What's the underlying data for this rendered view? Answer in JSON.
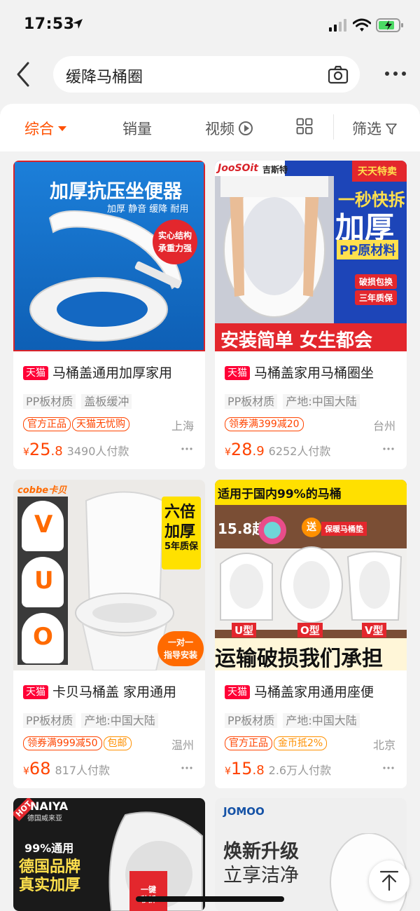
{
  "status_bar": {
    "time": "17:53"
  },
  "search": {
    "query": "缓降马桶圈"
  },
  "filters": [
    {
      "label": "综合"
    },
    {
      "label": "销量"
    },
    {
      "label": "视频"
    },
    {
      "label": "筛选"
    }
  ],
  "products": [
    {
      "img_headline": "加厚抗压坐便器",
      "img_sub": "加厚 静音 缓降 耐用",
      "img_badge_1": "实心结构",
      "img_badge_2": "承重力强",
      "badge": "天猫",
      "title": "马桶盖通用加厚家用",
      "tags": [
        "PP板材质",
        "盖板缓冲"
      ],
      "promos": [
        "官方正品",
        "天猫无忧购"
      ],
      "city": "上海",
      "price_int": "25",
      "price_dec": ".8",
      "sales": "3490人付款"
    },
    {
      "img_brand": "JooSOit",
      "img_brand_cn": "吉斯特",
      "img_corner": "天天特卖",
      "img_line_1": "一秒快拆",
      "img_line_2": "加厚",
      "img_line_3": "PP原材料",
      "img_badge_1": "破损包换",
      "img_badge_2": "三年质保",
      "img_bottom": "安装简单 女生都会",
      "badge": "天猫",
      "title": "马桶盖家用马桶圈坐",
      "tags": [
        "PP板材质",
        "产地:中国大陆"
      ],
      "promos": [
        "领券满399减20"
      ],
      "city": "台州",
      "price_int": "28",
      "price_dec": ".9",
      "sales": "6252人付款"
    },
    {
      "img_brand": "cobbe卡贝",
      "img_letters": [
        "V",
        "U",
        "O"
      ],
      "img_side_1": "六倍",
      "img_side_2": "加厚",
      "img_side_3": "5年质保",
      "img_btn_1": "一对一",
      "img_btn_2": "指导安装",
      "badge": "天猫",
      "title": "卡贝马桶盖 家用通用",
      "tags": [
        "PP板材质",
        "产地:中国大陆"
      ],
      "promos": [
        "领券满999减50",
        "包邮"
      ],
      "city": "温州",
      "price_int": "68",
      "price_dec": "",
      "sales": "817人付款"
    },
    {
      "img_top": "适用于国内99%的马桶",
      "img_price": "15.8起",
      "img_gift_1": "送",
      "img_gift_2": "保暖马桶垫",
      "img_types": [
        "U型",
        "O型",
        "V型"
      ],
      "img_bottom": "运输破损我们承担",
      "badge": "天猫",
      "title": "马桶盖家用通用座便",
      "tags": [
        "PP板材质",
        "产地:中国大陆"
      ],
      "promos": [
        "官方正品",
        "金币抵2%"
      ],
      "city": "北京",
      "price_int": "15",
      "price_dec": ".8",
      "sales": "2.6万人付款"
    },
    {
      "img_hot": "HOT",
      "img_brand": "NAIYA",
      "img_brand_sub": "德国威来亚",
      "img_line_1": "99%通用",
      "img_line_2": "德国品牌",
      "img_line_3": "真实加厚",
      "img_btn_1": "一键",
      "img_btn_2": "秒拆"
    },
    {
      "img_brand": "JOMOO",
      "img_line_1": "焕新升级",
      "img_line_2": "立享洁净"
    }
  ],
  "colors": {
    "accent": "#ff5000",
    "tmall_red": "#ff0036",
    "price": "#ff4400"
  }
}
